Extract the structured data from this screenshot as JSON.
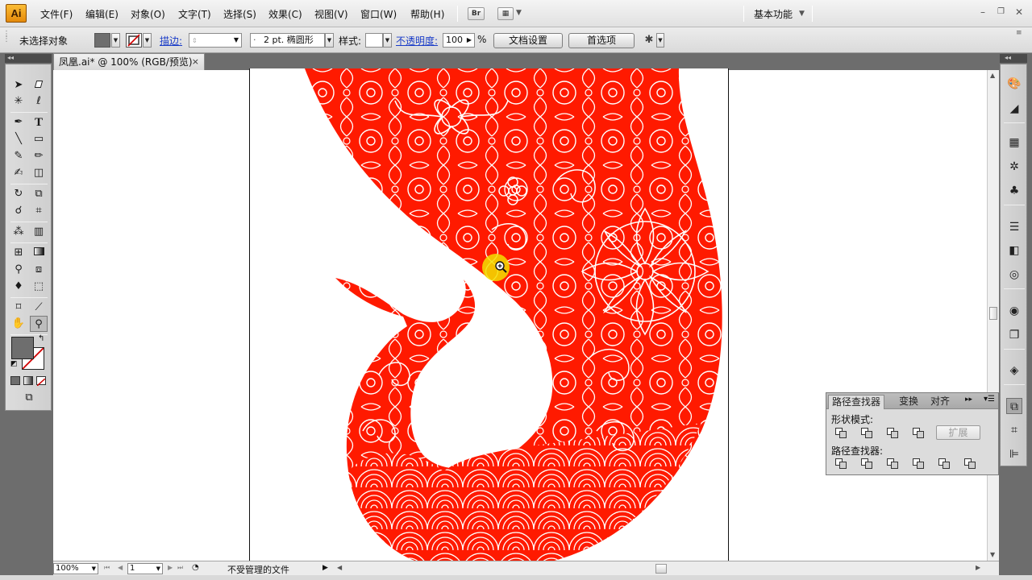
{
  "app": {
    "logo": "Ai",
    "workspace": "基本功能"
  },
  "menu": [
    "文件(F)",
    "编辑(E)",
    "对象(O)",
    "文字(T)",
    "选择(S)",
    "效果(C)",
    "视图(V)",
    "窗口(W)",
    "帮助(H)"
  ],
  "bridge_button": "Br",
  "control": {
    "selection_status": "未选择对象",
    "stroke_label": "描边:",
    "brush_value": "2 pt. 椭圆形",
    "style_label": "样式:",
    "opacity_label": "不透明度:",
    "opacity_value": "100",
    "opacity_unit": "%",
    "doc_setup": "文档设置",
    "preferences": "首选项"
  },
  "document": {
    "tab_title": "凤凰.ai* @ 100% (RGB/预览)",
    "close": "×"
  },
  "status": {
    "zoom": "100%",
    "artboard": "1",
    "info": "不受管理的文件"
  },
  "pathfinder": {
    "tabs": [
      "路径查找器",
      "变换",
      "对齐"
    ],
    "shape_modes_label": "形状模式:",
    "pathfinders_label": "路径查找器:",
    "expand_label": "扩展"
  },
  "colors": {
    "artwork_fill": "#ff1a00",
    "pattern_line": "#ffffff",
    "cursor_highlight": "#f2e000",
    "fill_swatch": "#6e6e6e"
  },
  "icons": {
    "tools": [
      "selection-tool",
      "direct-selection-tool",
      "magic-wand-tool",
      "lasso-tool",
      "pen-tool",
      "type-tool",
      "line-tool",
      "rectangle-tool",
      "paintbrush-tool",
      "pencil-tool",
      "blob-brush-tool",
      "eraser-tool",
      "rotate-tool",
      "scale-tool",
      "warp-tool",
      "free-transform-tool",
      "symbol-sprayer-tool",
      "column-graph-tool",
      "mesh-tool",
      "gradient-tool",
      "eyedropper-tool",
      "blend-tool",
      "live-paint-bucket-tool",
      "live-paint-selection-tool",
      "artboard-tool",
      "slice-tool",
      "hand-tool",
      "zoom-tool"
    ]
  }
}
